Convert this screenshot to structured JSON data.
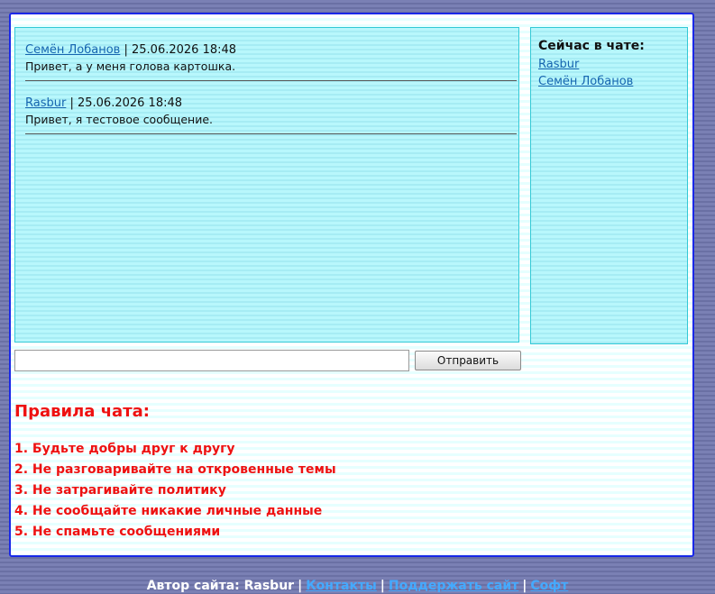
{
  "messages": [
    {
      "author": "Семён Лобанов",
      "sep": " | ",
      "datetime": "25.06.2026 18:48",
      "text": "Привет, а у меня голова картошка."
    },
    {
      "author": "Rasbur",
      "sep": " | ",
      "datetime": "25.06.2026 18:48",
      "text": "Привет, я тестовое сообщение."
    }
  ],
  "online": {
    "title": "Сейчас в чате:",
    "users": [
      "Rasbur",
      "Семён Лобанов"
    ]
  },
  "input": {
    "value": "",
    "placeholder": ""
  },
  "send_label": "Отправить",
  "rules": {
    "title": "Правила чата:",
    "items": [
      "1. Будьте добры друг к другу",
      "2. Не разговаривайте на откровенные темы",
      "3. Не затрагивайте политику",
      "4. Не сообщайте никакие личные данные",
      "5. Не спамьте сообщениями"
    ]
  },
  "footer": {
    "author_text": "Автор сайта: Rasbur",
    "separator": "|",
    "links": [
      "Контакты",
      "Поддержать сайт",
      "Софт"
    ]
  },
  "colors": {
    "page_border": "#1a28e8",
    "panel_bg": "#b4f5fb",
    "rules_text": "#ee1111",
    "link": "#1665b0",
    "footer_link": "#44aaff"
  }
}
